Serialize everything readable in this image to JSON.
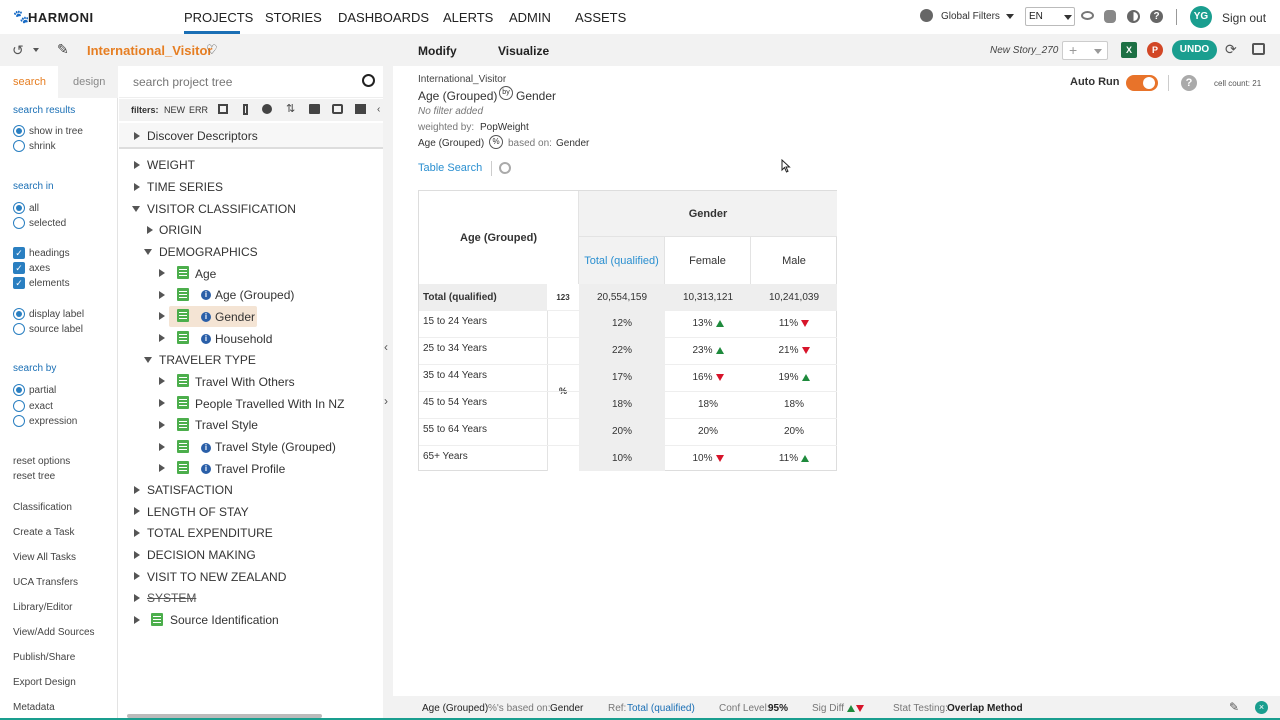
{
  "brand": {
    "name": "HARMONI",
    "logo": "paw-icon"
  },
  "nav": {
    "items": [
      "PROJECTS",
      "STORIES",
      "DASHBOARDS",
      "ALERTS",
      "ADMIN",
      "ASSETS"
    ],
    "active": "PROJECTS"
  },
  "topright": {
    "global_filters": "Global Filters",
    "language": "EN",
    "avatar_initials": "YG",
    "signout": "Sign out",
    "avatar_color": "#1a9e8f"
  },
  "project": {
    "name": "International_Visitor",
    "color": "#e67e22"
  },
  "tabs": {
    "modify": "Modify",
    "visualize": "Visualize"
  },
  "story": {
    "name": "New Story_270",
    "undo": "UNDO"
  },
  "left_tabs": {
    "search": "search",
    "design": "design"
  },
  "search_input": {
    "placeholder": "search project tree"
  },
  "filters": {
    "label": "filters:",
    "new": "NEW",
    "err": "ERR"
  },
  "options": {
    "search_results": "search results",
    "show_in_tree": "show in tree",
    "shrink": "shrink",
    "search_in": "search in",
    "all": "all",
    "selected": "selected",
    "headings": "headings",
    "axes": "axes",
    "elements": "elements",
    "display_label": "display label",
    "source_label": "source label",
    "search_by": "search by",
    "partial": "partial",
    "exact": "exact",
    "expression": "expression",
    "reset_options": "reset options",
    "reset_tree": "reset tree",
    "links": [
      "Classification",
      "Create a Task",
      "View All Tasks",
      "UCA Transfers",
      "Library/Editor",
      "View/Add Sources",
      "Publish/Share",
      "Export Design",
      "Metadata"
    ]
  },
  "tree": {
    "discover": "Discover Descriptors",
    "weight": "WEIGHT",
    "time_series": "TIME SERIES",
    "visitor_classification": "VISITOR CLASSIFICATION",
    "origin": "ORIGIN",
    "demographics": "DEMOGRAPHICS",
    "age": "Age",
    "age_grouped": "Age (Grouped)",
    "gender": "Gender",
    "household": "Household",
    "traveler_type": "TRAVELER TYPE",
    "travel_with_others": "Travel With Others",
    "people_travelled": "People Travelled With In NZ",
    "travel_style": "Travel Style",
    "travel_style_grouped": "Travel Style (Grouped)",
    "travel_profile": "Travel Profile",
    "satisfaction": "SATISFACTION",
    "length_of_stay": "LENGTH OF STAY",
    "total_expenditure": "TOTAL EXPENDITURE",
    "decision_making": "DECISION MAKING",
    "visit_nz": "VISIT TO NEW ZEALAND",
    "system": "SYSTEM",
    "source_identification": "Source Identification"
  },
  "report": {
    "source": "International_Visitor",
    "row_var": "Age (Grouped)",
    "by": "by",
    "col_var": "Gender",
    "no_filter": "No filter added",
    "weighted_label": "weighted by:",
    "weight_var": "PopWeight",
    "pct_row": "Age (Grouped)",
    "pct_symbol": "%",
    "based_on_label": "based on:",
    "based_on_var": "Gender",
    "table_search": "Table Search",
    "auto_run": "Auto Run",
    "cell_count": "cell count: 21"
  },
  "table": {
    "row_header": "Age (Grouped)",
    "col_group": "Gender",
    "columns": [
      "Total (qualified)",
      "Female",
      "Male"
    ],
    "total_row": {
      "label": "Total (qualified)",
      "stat": "123",
      "values": [
        "20,554,159",
        "10,313,121",
        "10,241,039"
      ]
    },
    "pct_label": "%",
    "rows": [
      {
        "label": "15 to 24 Years",
        "values": [
          "12%",
          "13%",
          "11%"
        ],
        "sig": [
          "",
          "up",
          "down"
        ]
      },
      {
        "label": "25 to 34 Years",
        "values": [
          "22%",
          "23%",
          "21%"
        ],
        "sig": [
          "",
          "up",
          "down"
        ]
      },
      {
        "label": "35 to 44 Years",
        "values": [
          "17%",
          "16%",
          "19%"
        ],
        "sig": [
          "",
          "down",
          "up"
        ]
      },
      {
        "label": "45 to 54 Years",
        "values": [
          "18%",
          "18%",
          "18%"
        ],
        "sig": [
          "",
          "",
          ""
        ]
      },
      {
        "label": "55 to 64 Years",
        "values": [
          "20%",
          "20%",
          "20%"
        ],
        "sig": [
          "",
          "",
          ""
        ]
      },
      {
        "label": "65+ Years",
        "values": [
          "10%",
          "10%",
          "11%"
        ],
        "sig": [
          "",
          "down",
          "up"
        ]
      }
    ]
  },
  "status": {
    "row_var": "Age (Grouped)",
    "pct_based_label": "%'s based on:",
    "pct_based_var": "Gender",
    "ref_label": "Ref:",
    "ref_value": "Total (qualified)",
    "conf_label": "Conf Level:",
    "conf_value": "95%",
    "sig_label": "Sig Diff",
    "stat_label": "Stat Testing:",
    "stat_value": "Overlap Method"
  },
  "colors": {
    "accent": "#1a6fb5",
    "up": "#1e8a3c",
    "down": "#d7142a",
    "undo": "#1a9e8f",
    "toggle": "#e8732a"
  }
}
